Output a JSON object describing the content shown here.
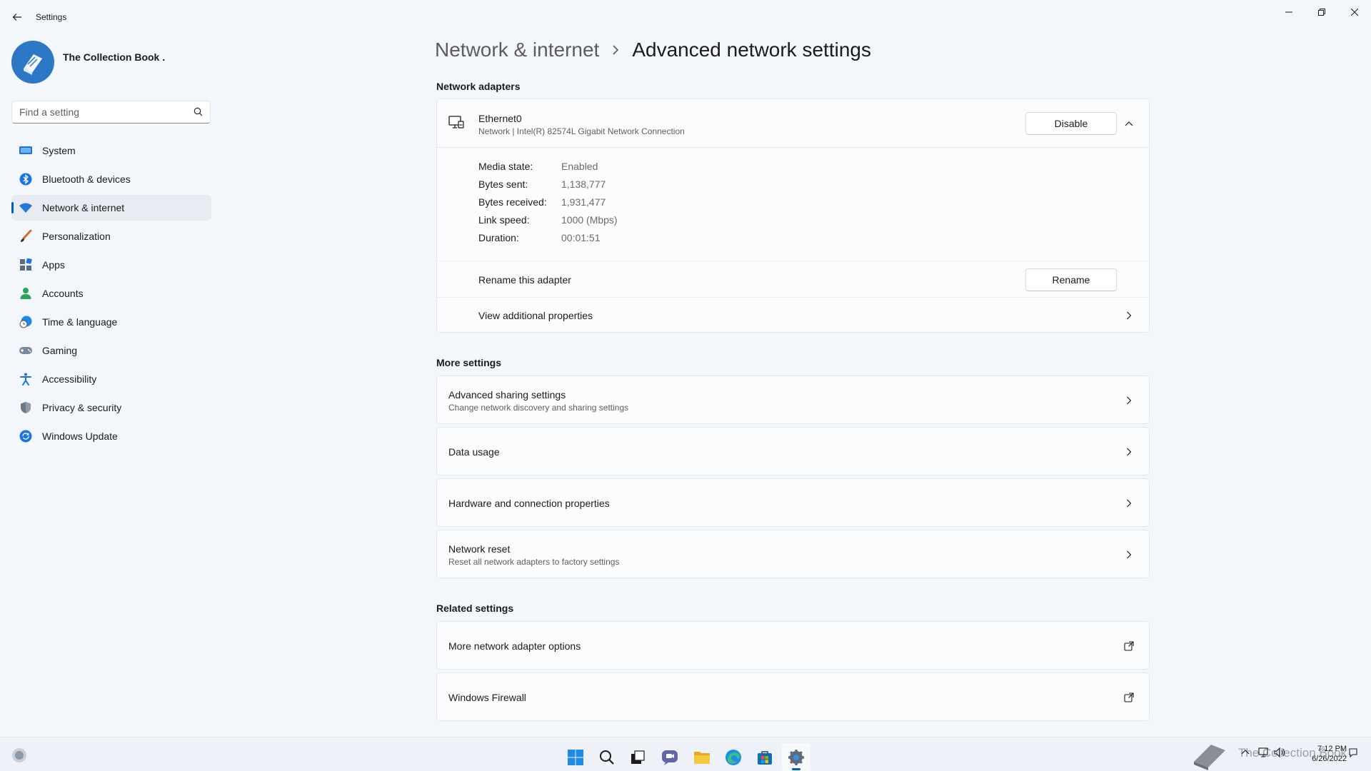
{
  "window": {
    "title": "Settings",
    "back_icon": "arrow-left-icon",
    "controls": [
      "minimize-icon",
      "restore-icon",
      "close-icon"
    ]
  },
  "profile": {
    "name": "The Collection Book .",
    "avatar_icon": "book-icon"
  },
  "search": {
    "placeholder": "Find a setting",
    "value": ""
  },
  "nav": {
    "active": "Network & internet",
    "items": [
      {
        "label": "System",
        "icon": "display-icon",
        "color": "#1a73e8"
      },
      {
        "label": "Bluetooth & devices",
        "icon": "bluetooth-icon",
        "color": "#1a73e8"
      },
      {
        "label": "Network & internet",
        "icon": "wifi-icon",
        "color": "#2378d8"
      },
      {
        "label": "Personalization",
        "icon": "brush-icon",
        "color": "#d86b2b"
      },
      {
        "label": "Apps",
        "icon": "apps-icon",
        "color": "#5a6d86"
      },
      {
        "label": "Accounts",
        "icon": "person-icon",
        "color": "#29a55a"
      },
      {
        "label": "Time & language",
        "icon": "globe-clock-icon",
        "color": "#1e88e5"
      },
      {
        "label": "Gaming",
        "icon": "gamepad-icon",
        "color": "#7a8a9a"
      },
      {
        "label": "Accessibility",
        "icon": "accessibility-icon",
        "color": "#1a73e8"
      },
      {
        "label": "Privacy & security",
        "icon": "shield-icon",
        "color": "#6c7a88"
      },
      {
        "label": "Windows Update",
        "icon": "sync-icon",
        "color": "#1a73e8"
      }
    ]
  },
  "breadcrumb": {
    "parent": "Network & internet",
    "current": "Advanced network settings"
  },
  "adapters": {
    "heading": "Network adapters",
    "adapter": {
      "name": "Ethernet0",
      "description": "Network | Intel(R) 82574L Gigabit Network Connection",
      "disable_label": "Disable",
      "stats": [
        {
          "key": "Media state:",
          "value": "Enabled"
        },
        {
          "key": "Bytes sent:",
          "value": "1,138,777"
        },
        {
          "key": "Bytes received:",
          "value": "1,931,477"
        },
        {
          "key": "Link speed:",
          "value": "1000 (Mbps)"
        },
        {
          "key": "Duration:",
          "value": "00:01:51"
        }
      ],
      "rename_text": "Rename this adapter",
      "rename_label": "Rename",
      "props_text": "View additional properties"
    }
  },
  "more_settings": {
    "heading": "More settings",
    "items": [
      {
        "title": "Advanced sharing settings",
        "subtitle": "Change network discovery and sharing settings"
      },
      {
        "title": "Data usage",
        "subtitle": ""
      },
      {
        "title": "Hardware and connection properties",
        "subtitle": ""
      },
      {
        "title": "Network reset",
        "subtitle": "Reset all network adapters to factory settings"
      }
    ]
  },
  "related_settings": {
    "heading": "Related settings",
    "items": [
      {
        "title": "More network adapter options",
        "icon": "open-external-icon"
      },
      {
        "title": "Windows Firewall",
        "icon": "open-external-icon"
      }
    ]
  },
  "taskbar": {
    "apps": [
      "start-icon",
      "search-icon",
      "task-view-icon",
      "chat-icon",
      "file-explorer-icon",
      "edge-icon",
      "store-icon",
      "settings-icon"
    ],
    "active_app": "settings-icon",
    "tray": {
      "time": "7:12 PM",
      "date": "6/26/2022",
      "watermark": "The Collection Book"
    }
  },
  "colors": {
    "accent": "#005fb8",
    "background": "#f3f6fb",
    "card": "#fbfcfe"
  }
}
